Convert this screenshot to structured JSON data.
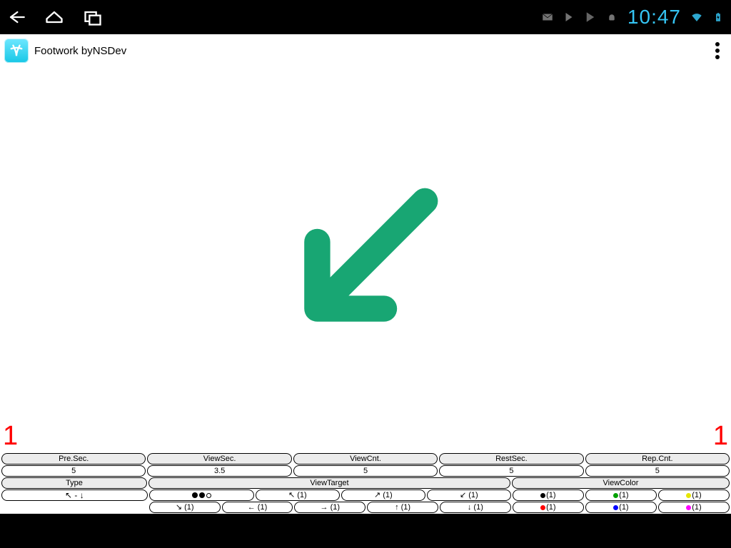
{
  "statusbar": {
    "clock": "10:47"
  },
  "actionbar": {
    "title": "Footwork byNSDev"
  },
  "canvas": {
    "arrow_direction": "down-left",
    "counter_left": "1",
    "counter_right": "1"
  },
  "controls": {
    "row1_headers": [
      "Pre.Sec.",
      "ViewSec.",
      "ViewCnt.",
      "RestSec.",
      "Rep.Cnt."
    ],
    "row1_values": [
      "5",
      "3.5",
      "5",
      "5",
      "5"
    ],
    "type_header": "Type",
    "type_value_glyphs": "↖ - ↓",
    "viewtarget_header": "ViewTarget",
    "viewcolor_header": "ViewColor",
    "viewtarget_row1": {
      "dots": "●●○",
      "items": [
        "↖ (1)",
        "↗ (1)",
        "↙ (1)"
      ]
    },
    "viewtarget_row2": [
      "↘ (1)",
      "← (1)",
      "→ (1)",
      "↑ (1)",
      "↓ (1)"
    ],
    "viewcolor_row1": [
      {
        "color": "#000000",
        "label": "(1)"
      },
      {
        "color": "#00a000",
        "label": "(1)"
      },
      {
        "color": "#e6e600",
        "label": "(1)"
      }
    ],
    "viewcolor_row2": [
      {
        "color": "#ff0000",
        "label": "(1)"
      },
      {
        "color": "#0000ff",
        "label": "(1)"
      },
      {
        "color": "#ff00ff",
        "label": "(1)"
      }
    ]
  }
}
